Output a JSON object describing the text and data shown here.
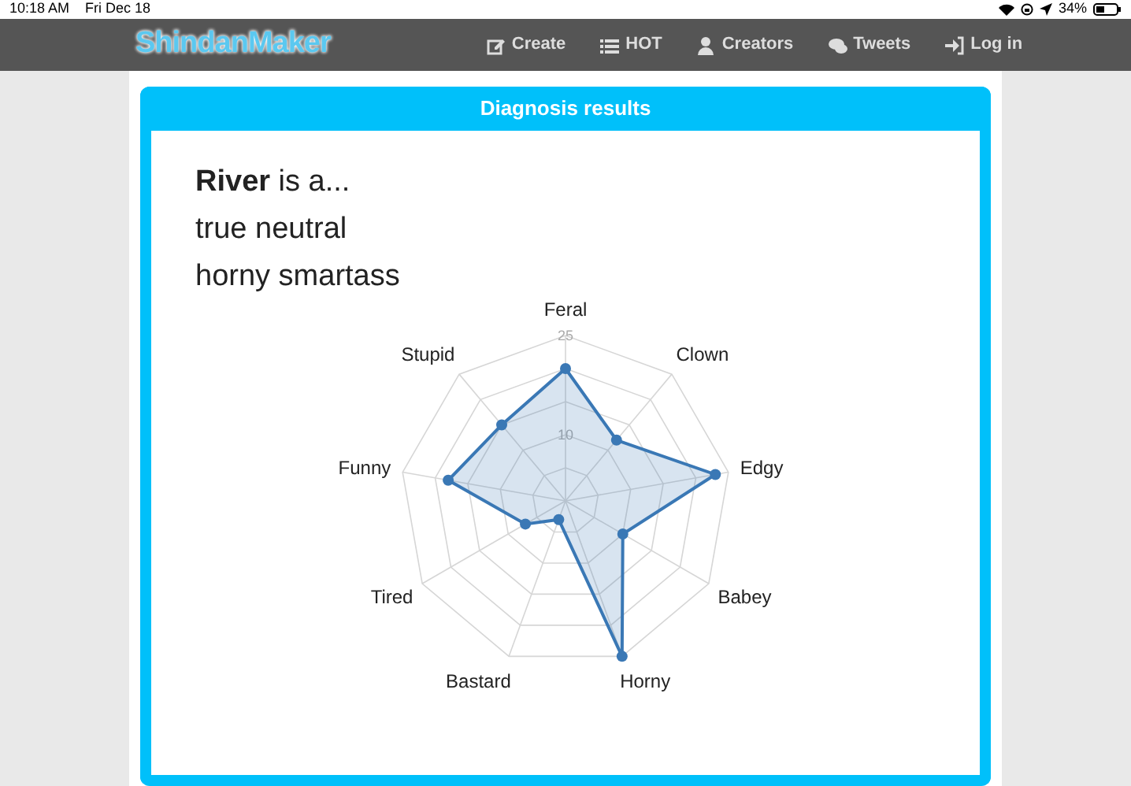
{
  "status_bar": {
    "time": "10:18 AM",
    "date": "Fri Dec 18",
    "battery": "34%"
  },
  "navbar": {
    "logo": "ShindanMaker",
    "items": [
      {
        "label": "Create"
      },
      {
        "label": "HOT"
      },
      {
        "label": "Creators"
      },
      {
        "label": "Tweets"
      },
      {
        "label": "Log in"
      }
    ]
  },
  "card": {
    "title": "Diagnosis results",
    "result_lines": [
      "**River** is a...",
      "true neutral",
      "horny smartass"
    ],
    "radar_chart": {
      "axis_labels": [
        "Feral",
        "Clown",
        "Edgy",
        "Babey",
        "Horny",
        "Bastard",
        "Tired",
        "Funny",
        "Stupid"
      ],
      "tick_labels": [
        "25",
        "10"
      ]
    }
  }
}
